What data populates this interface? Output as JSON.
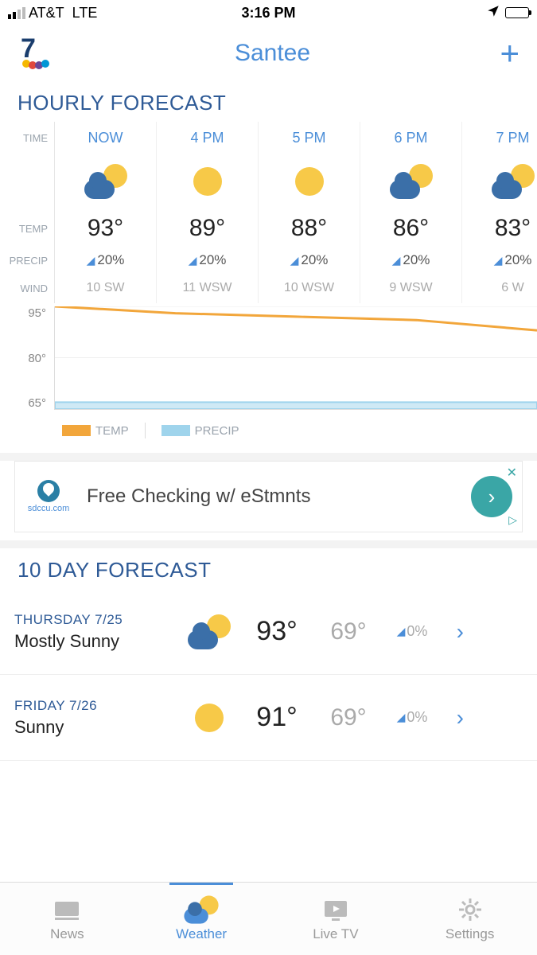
{
  "status": {
    "carrier": "AT&T",
    "network": "LTE",
    "time": "3:16 PM"
  },
  "header": {
    "location": "Santee"
  },
  "hourly": {
    "title": "HOURLY FORECAST",
    "labels": {
      "time": "TIME",
      "temp": "TEMP",
      "precip": "PRECIP",
      "wind": "WIND"
    },
    "hours": [
      {
        "time": "NOW",
        "icon": "cloud-sun",
        "temp": "93°",
        "precip": "20%",
        "wind": "10 SW"
      },
      {
        "time": "4 PM",
        "icon": "sun",
        "temp": "89°",
        "precip": "20%",
        "wind": "11 WSW"
      },
      {
        "time": "5 PM",
        "icon": "sun",
        "temp": "88°",
        "precip": "20%",
        "wind": "10 WSW"
      },
      {
        "time": "6 PM",
        "icon": "cloud-sun",
        "temp": "86°",
        "precip": "20%",
        "wind": "9 WSW"
      },
      {
        "time": "7 PM",
        "icon": "cloud-sun",
        "temp": "83°",
        "precip": "20%",
        "wind": "6 W"
      }
    ]
  },
  "chart_data": {
    "type": "line",
    "title": "",
    "xlabel": "",
    "ylabel": "",
    "ylim": [
      65,
      95
    ],
    "y_ticks": [
      "95°",
      "80°",
      "65°"
    ],
    "categories": [
      "NOW",
      "4 PM",
      "5 PM",
      "6 PM",
      "7 PM"
    ],
    "series": [
      {
        "name": "TEMP",
        "color": "#f2a63b",
        "values": [
          95,
          93,
          92,
          91,
          88
        ]
      },
      {
        "name": "PRECIP",
        "color": "#9fd4ec",
        "values": [
          67,
          67,
          67,
          67,
          67
        ]
      }
    ]
  },
  "legend": {
    "temp": "TEMP",
    "precip": "PRECIP"
  },
  "ad": {
    "brand": "sdccu.com",
    "text": "Free Checking w/ eStmnts"
  },
  "tenday": {
    "title": "10 DAY FORECAST",
    "days": [
      {
        "date": "THURSDAY 7/25",
        "cond": "Mostly Sunny",
        "icon": "cloud-sun",
        "hi": "93°",
        "lo": "69°",
        "precip": "0%"
      },
      {
        "date": "FRIDAY 7/26",
        "cond": "Sunny",
        "icon": "sun",
        "hi": "91°",
        "lo": "69°",
        "precip": "0%"
      }
    ]
  },
  "tabs": [
    {
      "label": "News"
    },
    {
      "label": "Weather"
    },
    {
      "label": "Live TV"
    },
    {
      "label": "Settings"
    }
  ]
}
